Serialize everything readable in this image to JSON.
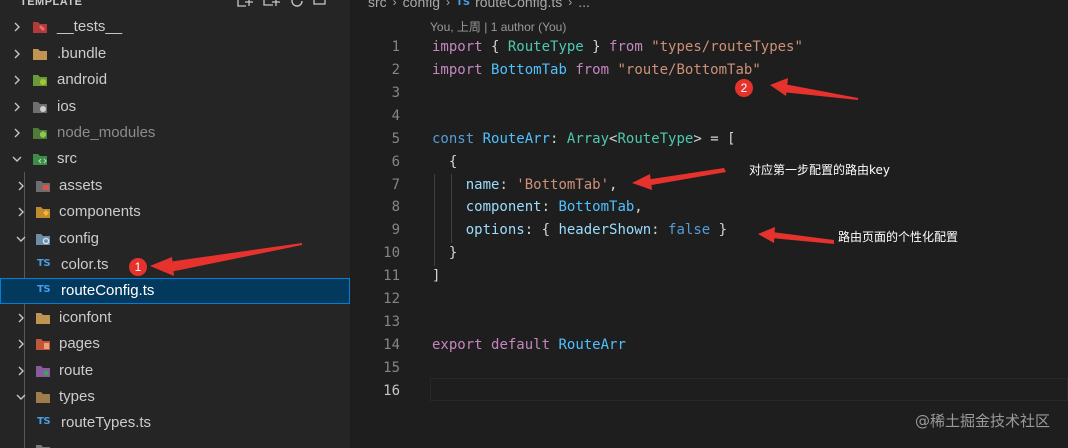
{
  "explorer": {
    "title": "TEMPLATE",
    "items": [
      {
        "label": "__tests__",
        "icon": "tests-folder-icon",
        "expanded": false
      },
      {
        "label": ".bundle",
        "icon": "folder-icon",
        "expanded": false
      },
      {
        "label": "android",
        "icon": "android-folder-icon",
        "expanded": false
      },
      {
        "label": "ios",
        "icon": "ios-folder-icon",
        "expanded": false
      },
      {
        "label": "node_modules",
        "icon": "node-folder-icon",
        "expanded": false
      },
      {
        "label": "src",
        "icon": "src-folder-icon",
        "expanded": true
      },
      {
        "label": "assets",
        "icon": "assets-folder-icon",
        "expanded": false
      },
      {
        "label": "components",
        "icon": "components-folder-icon",
        "expanded": false
      },
      {
        "label": "config",
        "icon": "config-folder-icon",
        "expanded": true
      },
      {
        "label": "color.ts",
        "icon": "ts-file-icon"
      },
      {
        "label": "routeConfig.ts",
        "icon": "ts-file-icon",
        "selected": true
      },
      {
        "label": "iconfont",
        "icon": "folder-icon",
        "expanded": false
      },
      {
        "label": "pages",
        "icon": "pages-folder-icon",
        "expanded": false
      },
      {
        "label": "route",
        "icon": "route-folder-icon",
        "expanded": false
      },
      {
        "label": "types",
        "icon": "types-folder-icon",
        "expanded": true
      },
      {
        "label": "routeTypes.ts",
        "icon": "ts-file-icon"
      }
    ],
    "file_badge": "TS"
  },
  "breadcrumb": {
    "segments": [
      "src",
      "config"
    ],
    "file_badge": "TS",
    "file": "routeConfig.ts",
    "more": "..."
  },
  "codelens": "You, 上周 | 1 author (You)",
  "line_numbers": [
    "1",
    "2",
    "3",
    "4",
    "5",
    "6",
    "7",
    "8",
    "9",
    "10",
    "11",
    "12",
    "13",
    "14",
    "15",
    "16"
  ],
  "active_line": "16",
  "code": {
    "l1": {
      "a": "import",
      "b": " { ",
      "c": "RouteType",
      "d": " } ",
      "e": "from",
      "f": " ",
      "g": "\"types/routeTypes\""
    },
    "l2": {
      "a": "import",
      "b": " ",
      "c": "BottomTab",
      "d": " ",
      "e": "from",
      "f": " ",
      "g": "\"route/BottomTab\""
    },
    "l5": {
      "a": "const",
      "b": " ",
      "c": "RouteArr",
      "d": ": ",
      "e": "Array",
      "f": "<",
      "g": "RouteType",
      "h": "> = ["
    },
    "l6": {
      "a": "  {"
    },
    "l7": {
      "a": "    ",
      "b": "name",
      "c": ": ",
      "d": "'BottomTab'",
      "e": ","
    },
    "l8": {
      "a": "    ",
      "b": "component",
      "c": ": ",
      "d": "BottomTab",
      "e": ","
    },
    "l9": {
      "a": "    ",
      "b": "options",
      "c": ": { ",
      "d": "headerShown",
      "e": ": ",
      "f": "false",
      "g": " }"
    },
    "l10": {
      "a": "  }"
    },
    "l11": {
      "a": "]"
    },
    "l14": {
      "a": "export",
      "b": " ",
      "c": "default",
      "d": " ",
      "e": "RouteArr"
    }
  },
  "annotations": {
    "badge1": "1",
    "badge2": "2",
    "note_key": "对应第一步配置的路由key",
    "note_options": "路由页面的个性化配置",
    "arrow_color": "#e5322d"
  },
  "watermark": "@稀土掘金技术社区",
  "colors": {
    "sidebar_bg": "#252526",
    "editor_bg": "#1e1e1e",
    "selection_bg": "#04395e",
    "selection_border": "#007fd4",
    "keyword": "#c586c0",
    "type": "#4ec9b0",
    "string": "#ce9178",
    "property": "#9cdcfe",
    "constant": "#4fc1ff"
  }
}
